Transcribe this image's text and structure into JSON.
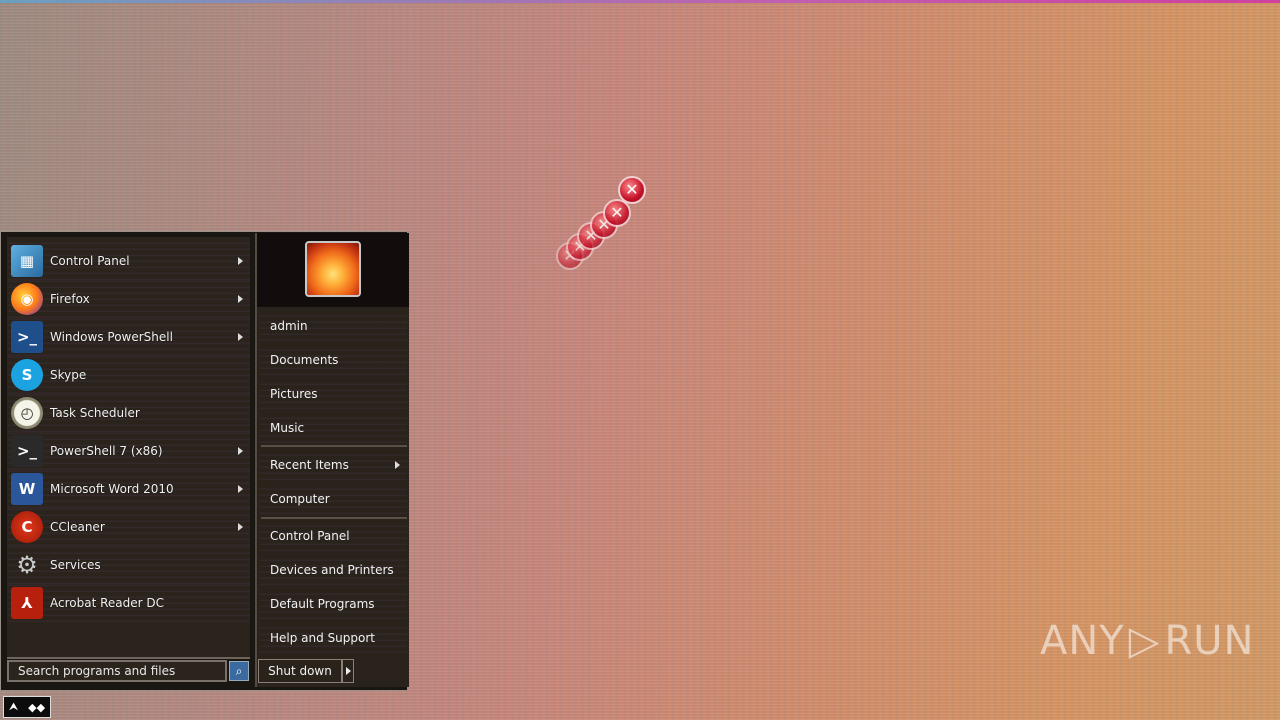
{
  "start_menu": {
    "programs": [
      {
        "label": "Control Panel",
        "icon": "control-panel-icon",
        "has_arrow": true
      },
      {
        "label": "Firefox",
        "icon": "firefox-icon",
        "has_arrow": true
      },
      {
        "label": "Windows PowerShell",
        "icon": "powershell-icon",
        "has_arrow": true
      },
      {
        "label": "Skype",
        "icon": "skype-icon",
        "has_arrow": false
      },
      {
        "label": "Task Scheduler",
        "icon": "task-scheduler-icon",
        "has_arrow": false
      },
      {
        "label": "PowerShell 7 (x86)",
        "icon": "powershell7-icon",
        "has_arrow": true
      },
      {
        "label": "Microsoft Word 2010",
        "icon": "word-icon",
        "has_arrow": true
      },
      {
        "label": "CCleaner",
        "icon": "ccleaner-icon",
        "has_arrow": true
      },
      {
        "label": "Services",
        "icon": "services-gear-icon",
        "has_arrow": false
      },
      {
        "label": "Acrobat Reader DC",
        "icon": "acrobat-icon",
        "has_arrow": false
      }
    ],
    "right_items": {
      "user": "admin",
      "documents": "Documents",
      "pictures": "Pictures",
      "music": "Music",
      "recent_items": "Recent Items",
      "computer": "Computer",
      "control_panel": "Control Panel",
      "devices_printers": "Devices and Printers",
      "default_programs": "Default Programs",
      "help_support": "Help and Support"
    },
    "search_placeholder": "Search programs and files",
    "shutdown_label": "Shut down"
  },
  "watermark": {
    "left": "ANY",
    "right": "RUN"
  },
  "colors": {
    "menu_bg": "#1a1713",
    "pane_bg": "#2b241d",
    "error_red": "#c4122a"
  }
}
